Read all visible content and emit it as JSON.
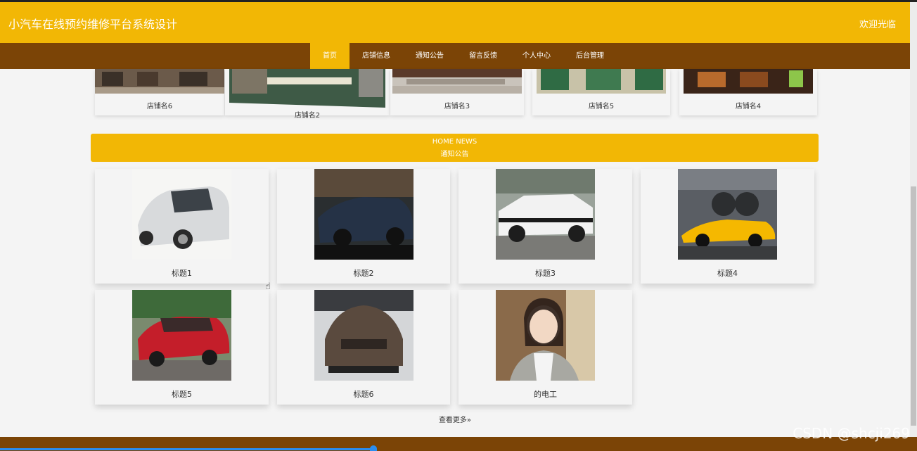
{
  "header": {
    "title": "小汽车在线预约维修平台系统设计",
    "welcome": "欢迎光临"
  },
  "nav": {
    "items": [
      "首页",
      "店铺信息",
      "通知公告",
      "留言反馈",
      "个人中心",
      "后台管理"
    ],
    "active": "首页"
  },
  "stores": [
    "店铺名6",
    "店铺名2",
    "店铺名3",
    "店铺名5",
    "店铺名4"
  ],
  "news_section": {
    "title_en": "HOME NEWS",
    "title_cn": "通知公告"
  },
  "news_items": [
    "标题1",
    "标题2",
    "标题3",
    "标题4",
    "标题5",
    "标题6",
    "的电工"
  ],
  "more_link": "查看更多»",
  "watermark": "CSDN @shcji269",
  "colors": {
    "accent": "#f2b705",
    "nav_bg": "#7b4406",
    "page_bg": "#f4f4f4"
  }
}
